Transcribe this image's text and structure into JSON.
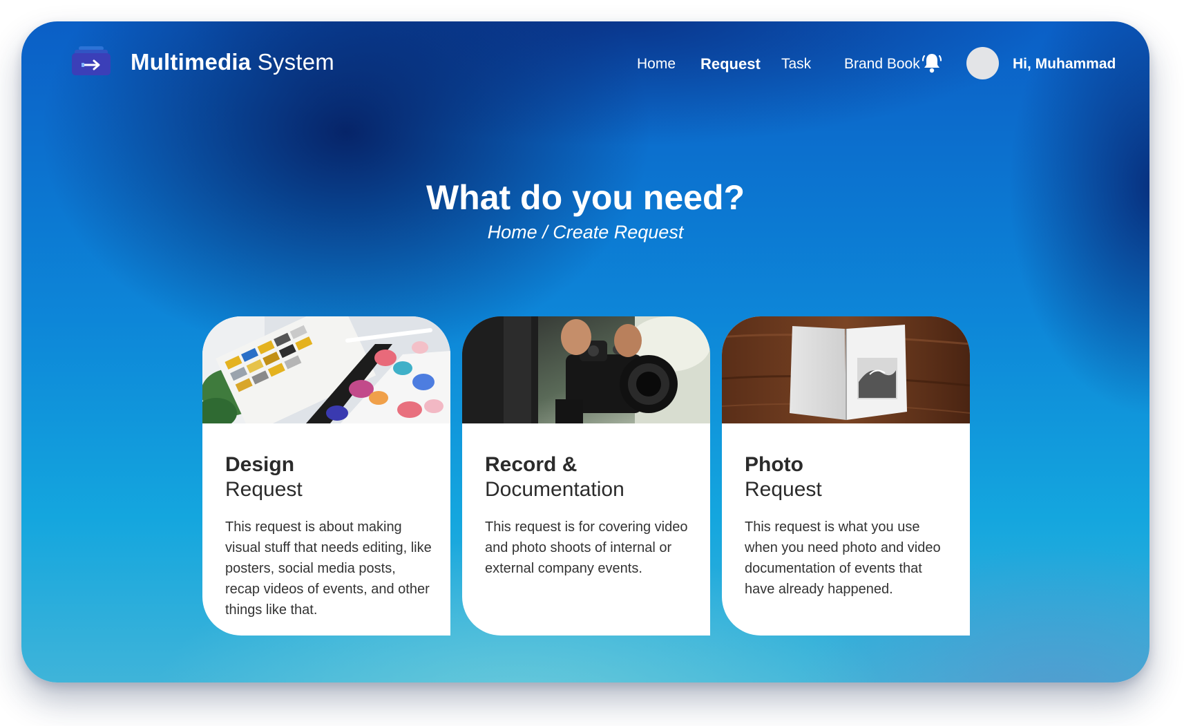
{
  "app": {
    "brand_bold": "Multimedia",
    "brand_regular": " System",
    "logo_icon": "stacked-tray-arrow-icon"
  },
  "nav": {
    "items": [
      {
        "label": "Home",
        "active": false
      },
      {
        "label": "Request",
        "active": true
      },
      {
        "label": "Task",
        "active": false
      },
      {
        "label": "Brand Book",
        "active": false
      }
    ],
    "notification_icon": "bell-icon",
    "greeting": "Hi, Muhammad"
  },
  "hero": {
    "title": "What do you need?",
    "breadcrumb": {
      "home": "Home",
      "separator": " / ",
      "current": "Create Request"
    }
  },
  "cards": [
    {
      "title_bold": "Design",
      "title_regular": "Request",
      "description": "This request is about making visual stuff that needs editing, like posters, social media posts, recap videos of events, and other things like that."
    },
    {
      "title_bold": "Record &",
      "title_regular": "Documentation",
      "description": "This request is for covering video and photo shoots of internal or external company events."
    },
    {
      "title_bold": "Photo",
      "title_regular": "Request",
      "description": "This request is what you use when you need photo and video documentation of events that have already happened."
    }
  ],
  "colors": {
    "accent_dark": "#0b3a8f",
    "accent": "#0d86d8",
    "card_bg": "#ffffff",
    "text_dark": "#2b2b2b",
    "logo_purple": "#3b3fb8"
  }
}
